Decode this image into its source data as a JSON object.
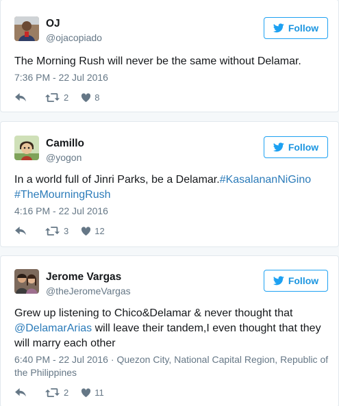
{
  "colors": {
    "accent": "#1da1f2",
    "link": "#2b7bb9",
    "muted": "#657786",
    "text": "#14171a"
  },
  "tweets": [
    {
      "name": "OJ",
      "handle": "@ojacopiado",
      "follow_label": "Follow",
      "text": "The Morning Rush will never be the same without Delamar.",
      "link_text": "",
      "time": "7:36 PM - 22 Jul 2016",
      "location": "",
      "retweets": "2",
      "likes": "8"
    },
    {
      "name": "Camillo",
      "handle": "@yogon",
      "follow_label": "Follow",
      "text": "In a world full of Jinri Parks, be a Delamar.",
      "link_text": "#KasalananNiGino #TheMourningRush",
      "time": "4:16 PM - 22 Jul 2016",
      "location": "",
      "retweets": "3",
      "likes": "12"
    },
    {
      "name": "Jerome Vargas",
      "handle": "@theJeromeVargas",
      "follow_label": "Follow",
      "text_before": "Grew up listening to Chico&Delamar & never thought that",
      "mention": "@DelamarArias",
      "text_after": " will leave their tandem,I even thought that they will marry each other",
      "time": "6:40 PM - 22 Jul 2016",
      "location": "Quezon City, National Capital Region, Republic of the Philippines",
      "retweets": "2",
      "likes": "11"
    }
  ]
}
